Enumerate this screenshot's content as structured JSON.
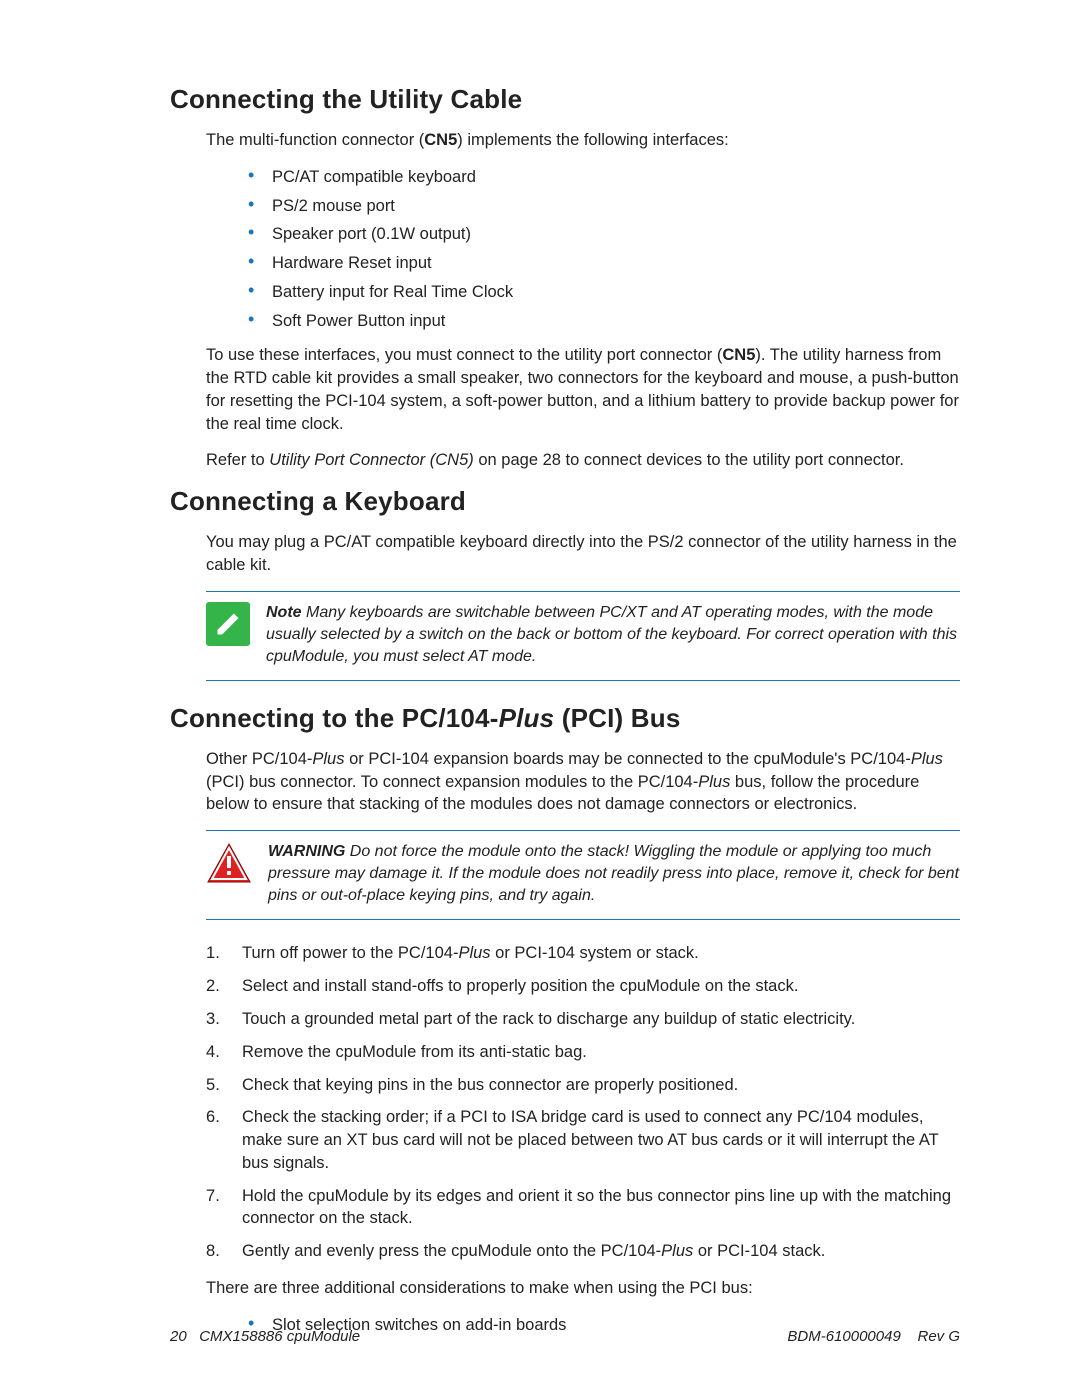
{
  "sections": {
    "utility": {
      "heading": "Connecting the Utility Cable",
      "intro_before": "The multi-function connector (",
      "intro_bold": "CN5",
      "intro_after": ") implements the following interfaces:",
      "bullets": [
        "PC/AT compatible keyboard",
        "PS/2 mouse port",
        "Speaker port (0.1W output)",
        "Hardware Reset input",
        "Battery input for Real Time Clock",
        "Soft Power Button input"
      ],
      "para2_a": "To use these interfaces, you must connect to the utility port connector (",
      "para2_bold": "CN5",
      "para2_b": "). The utility harness from the RTD cable kit provides a small speaker, two connectors for the keyboard and mouse, a push-button for resetting the PCI-104 system, a soft-power button, and a lithium battery to provide backup power for the real time clock.",
      "para3_a": "Refer to ",
      "para3_ital": "Utility Port Connector (CN5)",
      "para3_b": " on page 28 to connect devices to the utility port connector."
    },
    "keyboard": {
      "heading": "Connecting a Keyboard",
      "para": "You may plug a PC/AT compatible keyboard directly into the PS/2 connector of the utility harness in the cable kit.",
      "note_label": "Note",
      "note_text": "  Many keyboards are switchable between PC/XT and AT operating modes, with the mode usually selected by a switch on the back or bottom of the keyboard. For correct operation with this cpuModule, you must select AT mode."
    },
    "pcibus": {
      "heading_a": "Connecting to the PC/104-",
      "heading_ital": "Plus",
      "heading_b": " (PCI) Bus",
      "para1_a": "Other PC/104-",
      "para1_ital1": "Plus",
      "para1_b": " or PCI-104 expansion boards may be connected to the cpuModule's PC/104-",
      "para1_ital2": "Plus",
      "para1_c": " (PCI) bus connector. To connect expansion modules to the PC/104-",
      "para1_ital3": "Plus",
      "para1_d": " bus, follow the procedure below to ensure that stacking of the modules does not damage connectors or electronics.",
      "warn_label": "WARNING",
      "warn_text": "  Do not force the module onto the stack! Wiggling the module or applying too much pressure may damage it. If the module does not readily press into place, remove it, check for bent pins or out-of-place keying pins, and try again.",
      "steps_pre": [
        "Turn off power to the PC/104-"
      ],
      "step1_ital": "Plus",
      "step1_after": " or PCI-104 system or stack.",
      "step2": "Select and install stand-offs to properly position the cpuModule on the stack.",
      "step3": "Touch a grounded metal part of the rack to discharge any buildup of static electricity.",
      "step4": "Remove the cpuModule from its anti-static bag.",
      "step5": "Check that keying pins in the bus connector are properly positioned.",
      "step6": "Check the stacking order; if a PCI to ISA bridge card is used to connect any PC/104 modules, make sure an XT bus card will not be placed between two AT bus cards or it will interrupt the AT bus signals.",
      "step7": "Hold the cpuModule by its edges and orient it so the bus connector pins line up with the matching connector on the stack.",
      "step8_a": "Gently and evenly press the cpuModule onto the PC/104-",
      "step8_ital": "Plus",
      "step8_b": " or PCI-104 stack.",
      "para_after": "There are three additional considerations to make when using the PCI bus:",
      "bullets2": [
        "Slot selection switches on add-in boards"
      ]
    }
  },
  "footer": {
    "left_page": "20",
    "left_title": "CMX158886 cpuModule",
    "right_a": "BDM-610000049",
    "right_b": "Rev G"
  }
}
